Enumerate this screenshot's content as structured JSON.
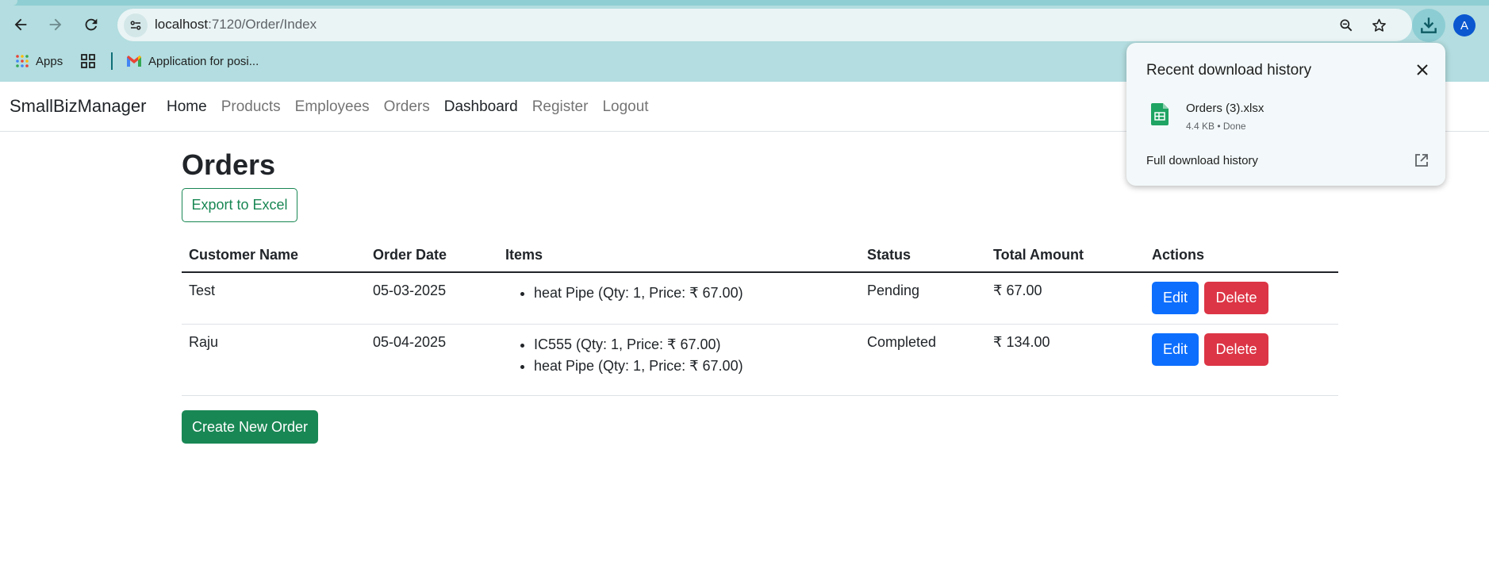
{
  "browser": {
    "url_host": "localhost",
    "url_path": ":7120/Order/Index",
    "avatar_letter": "A",
    "icons": [
      "back-arrow-icon",
      "forward-arrow-icon",
      "reload-icon",
      "site-info-icon",
      "zoom-icon",
      "star-icon",
      "download-icon"
    ],
    "bookmarks": {
      "apps_label": "Apps",
      "gmail_label": "Application for posi..."
    }
  },
  "download_popup": {
    "title": "Recent download history",
    "file_name": "Orders (3).xlsx",
    "file_meta": "4.4 KB • Done",
    "full_history_label": "Full download history"
  },
  "app": {
    "brand": "SmallBizManager",
    "nav": [
      "Home",
      "Products",
      "Employees",
      "Orders",
      "Dashboard",
      "Register",
      "Logout"
    ],
    "page_title": "Orders",
    "export_label": "Export to Excel",
    "create_label": "Create New Order",
    "table": {
      "headers": [
        "Customer Name",
        "Order Date",
        "Items",
        "Status",
        "Total Amount",
        "Actions"
      ],
      "rows": [
        {
          "customer": "Test",
          "date": "05-03-2025",
          "items": [
            "heat Pipe (Qty: 1, Price: ₹ 67.00)"
          ],
          "status": "Pending",
          "total": "₹ 67.00",
          "edit": "Edit",
          "delete": "Delete"
        },
        {
          "customer": "Raju",
          "date": "05-04-2025",
          "items": [
            "IC555 (Qty: 1, Price: ₹ 67.00)",
            "heat Pipe (Qty: 1, Price: ₹ 67.00)"
          ],
          "status": "Completed",
          "total": "₹ 134.00",
          "edit": "Edit",
          "delete": "Delete"
        }
      ]
    },
    "colors": {
      "primary": "#0d6efd",
      "danger": "#dc3545",
      "success": "#198754",
      "chrome": "#b3dde0"
    }
  }
}
